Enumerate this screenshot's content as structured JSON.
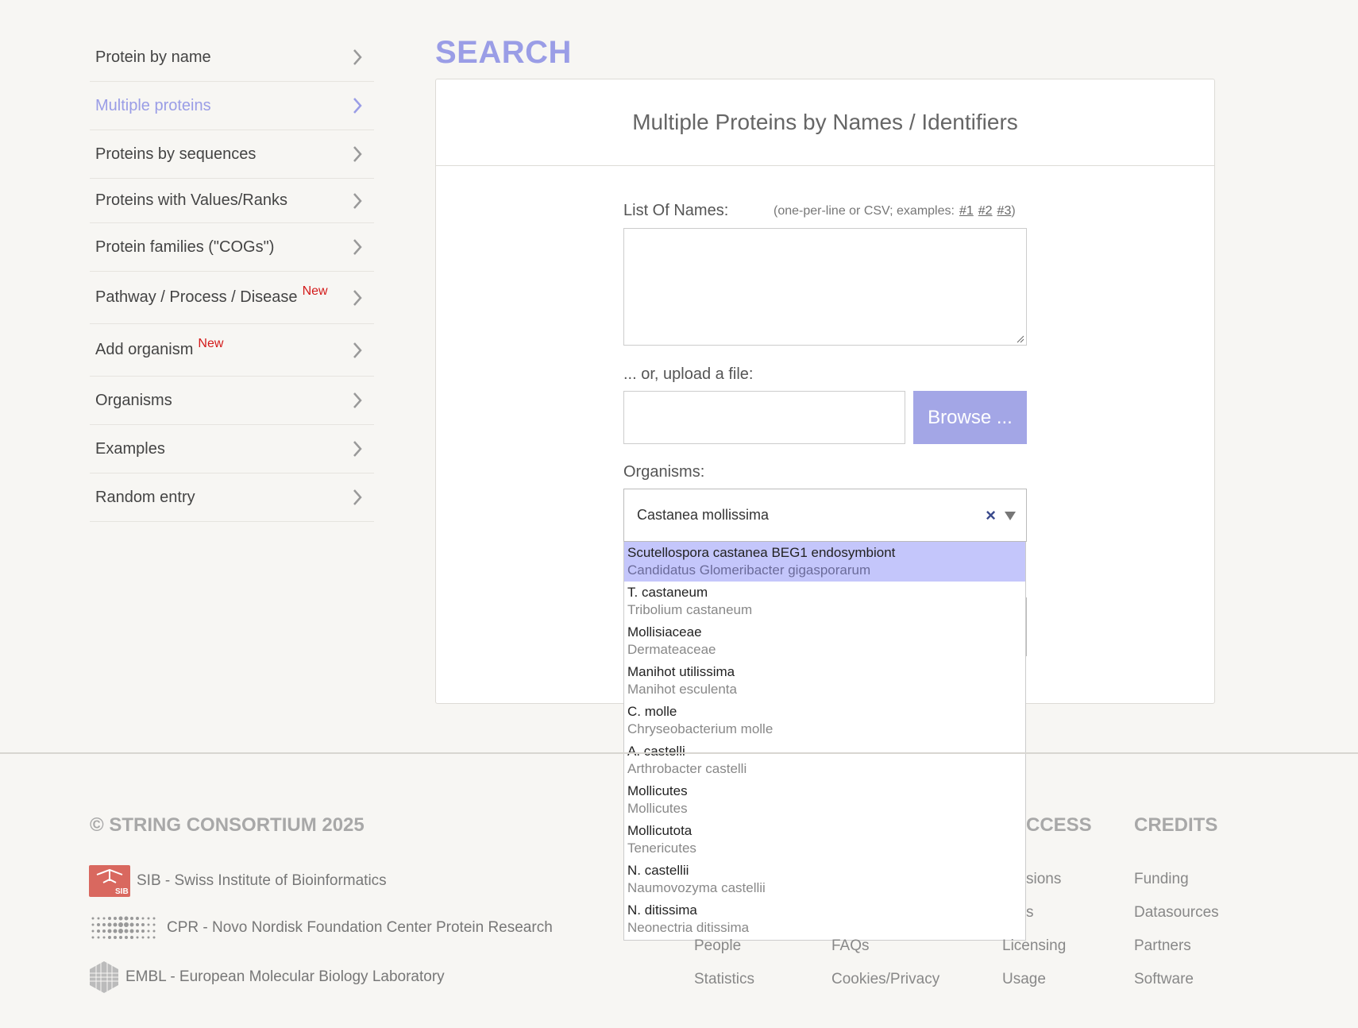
{
  "sidebar": {
    "items": [
      {
        "label": "Protein by name",
        "new": ""
      },
      {
        "label": "Multiple proteins",
        "new": ""
      },
      {
        "label": "Proteins by sequences",
        "new": ""
      },
      {
        "label": "Proteins with Values/Ranks",
        "new": ""
      },
      {
        "label": "Protein families (\"COGs\")",
        "new": ""
      },
      {
        "label": "Pathway / Process / Disease",
        "new": "New"
      },
      {
        "label": "Add organism",
        "new": "New"
      },
      {
        "label": "Organisms",
        "new": ""
      },
      {
        "label": "Examples",
        "new": ""
      },
      {
        "label": "Random entry",
        "new": ""
      }
    ],
    "active_index": 1
  },
  "main": {
    "title": "SEARCH",
    "panel_title": "Multiple Proteins by Names / Identifiers",
    "list_label": "List Of Names:",
    "list_hint_prefix": "(one-per-line or CSV; examples:",
    "list_hint_links": [
      "#1",
      "#2",
      "#3"
    ],
    "list_hint_suffix": ")",
    "list_value": "",
    "upload_label": "... or, upload a file:",
    "browse_label": "Browse ...",
    "organisms_label": "Organisms:",
    "organism_value": "Castanea mollissima",
    "clear_glyph": "×"
  },
  "dropdown": {
    "options": [
      {
        "primary": "Scutellospora castanea BEG1 endosymbiont",
        "secondary": "Candidatus Glomeribacter gigasporarum"
      },
      {
        "primary": "T. castaneum",
        "secondary": "Tribolium castaneum"
      },
      {
        "primary": "Mollisiaceae",
        "secondary": "Dermateaceae"
      },
      {
        "primary": "Manihot utilissima",
        "secondary": "Manihot esculenta"
      },
      {
        "primary": "C. molle",
        "secondary": "Chryseobacterium molle"
      },
      {
        "primary": "A. castelli",
        "secondary": "Arthrobacter castelli"
      },
      {
        "primary": "Mollicutes",
        "secondary": "Mollicutes"
      },
      {
        "primary": "Mollicutota",
        "secondary": "Tenericutes"
      },
      {
        "primary": "N. castellii",
        "secondary": "Naumovozyma castellii"
      },
      {
        "primary": "N. ditissima",
        "secondary": "Neonectria ditissima"
      }
    ],
    "highlighted_index": 0
  },
  "footer": {
    "copyright": "© STRING CONSORTIUM 2025",
    "partners": [
      {
        "label": "SIB - Swiss Institute of Bioinformatics",
        "logo_text": "SIB"
      },
      {
        "label": "CPR - Novo Nordisk Foundation Center Protein Research"
      },
      {
        "label": "EMBL - European Molecular Biology Laboratory"
      }
    ],
    "col_access_partial": "CCESS",
    "col_credits": "CREDITS",
    "col2_links": [
      "People",
      "Statistics"
    ],
    "col3_links": [
      "FAQs",
      "Cookies/Privacy"
    ],
    "col4_links": [
      "sions",
      "s",
      "Licensing",
      "Usage"
    ],
    "col5_links": [
      "Funding",
      "Datasources",
      "Partners",
      "Software"
    ]
  },
  "colors": {
    "accent": "#9a9de6",
    "button": "#a3a6e6",
    "highlight": "#c4c6fb",
    "new_badge": "#d31a1a"
  }
}
